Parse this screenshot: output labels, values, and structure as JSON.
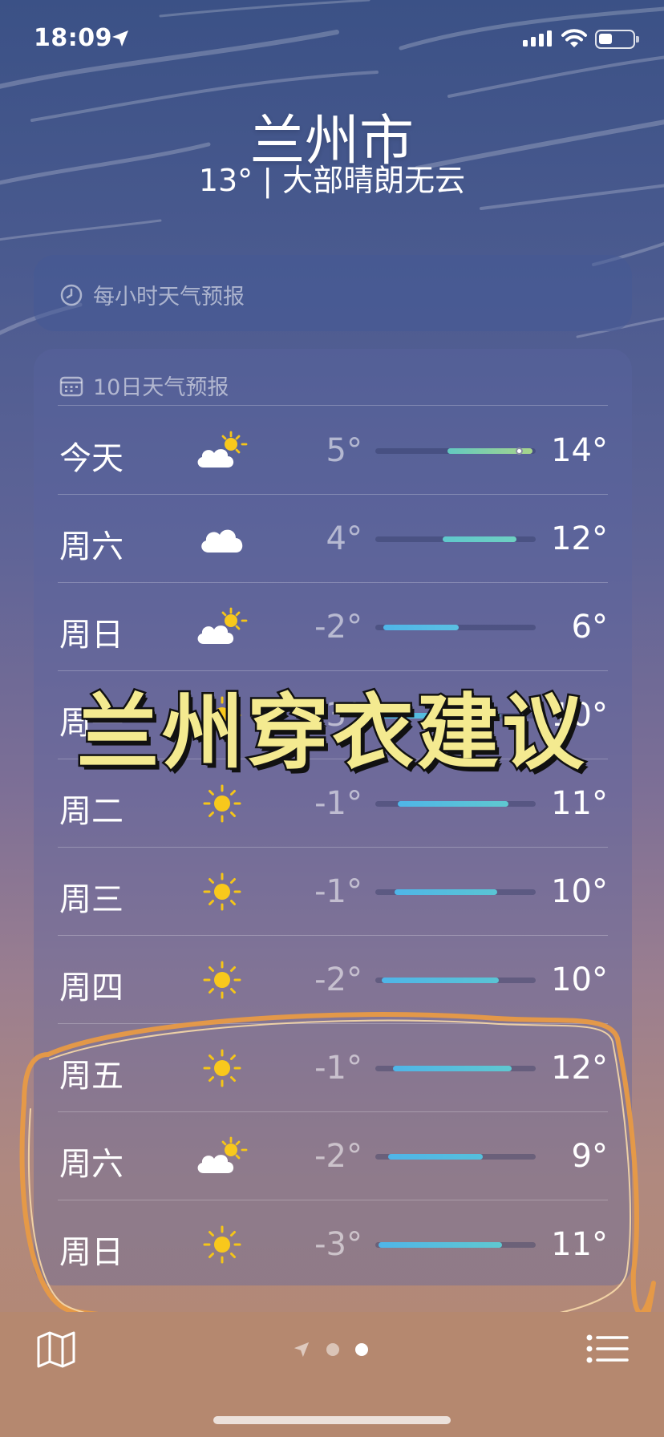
{
  "status_bar": {
    "time": "18:09",
    "battery_level": 0.4
  },
  "header": {
    "city": "兰州市",
    "summary": "13° | 大部晴朗无云"
  },
  "hourly_card": {
    "title": "每小时天气预报"
  },
  "daily_card": {
    "title": "10日天气预报",
    "days": [
      {
        "day": "今天",
        "icon": "partly-sunny-icon",
        "low": "5°",
        "high": "14°",
        "range": [
          0.45,
          0.98
        ],
        "current": 0.9,
        "colors": [
          "#62c9c1",
          "#a7d58a"
        ]
      },
      {
        "day": "周六",
        "icon": "cloud-icon",
        "low": "4°",
        "high": "12°",
        "range": [
          0.42,
          0.88
        ],
        "colors": [
          "#5fc8cc",
          "#6ed0c2"
        ]
      },
      {
        "day": "周日",
        "icon": "partly-sunny-icon",
        "low": "-2°",
        "high": "6°",
        "range": [
          0.05,
          0.52
        ],
        "colors": [
          "#4fb5e8",
          "#5ac0e2"
        ]
      },
      {
        "day": "周一",
        "icon": "sun-icon",
        "low": "-3°",
        "high": "10°",
        "range": [
          0.0,
          0.78
        ],
        "colors": [
          "#4fb5e8",
          "#5fc8d0"
        ]
      },
      {
        "day": "周二",
        "icon": "sun-icon",
        "low": "-1°",
        "high": "11°",
        "range": [
          0.14,
          0.83
        ],
        "colors": [
          "#4fb5e8",
          "#5fc8d0"
        ]
      },
      {
        "day": "周三",
        "icon": "sun-icon",
        "low": "-1°",
        "high": "10°",
        "range": [
          0.12,
          0.76
        ],
        "colors": [
          "#4fb5e8",
          "#5ac4d4"
        ]
      },
      {
        "day": "周四",
        "icon": "sun-icon",
        "low": "-2°",
        "high": "10°",
        "range": [
          0.04,
          0.77
        ],
        "colors": [
          "#4fb5e8",
          "#5ac4d4"
        ]
      },
      {
        "day": "周五",
        "icon": "sun-icon",
        "low": "-1°",
        "high": "12°",
        "range": [
          0.11,
          0.85
        ],
        "colors": [
          "#4fb5e8",
          "#5fc8d0"
        ]
      },
      {
        "day": "周六",
        "icon": "partly-sunny-icon",
        "low": "-2°",
        "high": "9°",
        "range": [
          0.08,
          0.67
        ],
        "colors": [
          "#4fb5e8",
          "#55c0dc"
        ]
      },
      {
        "day": "周日",
        "icon": "sun-icon",
        "low": "-3°",
        "high": "11°",
        "range": [
          0.02,
          0.79
        ],
        "colors": [
          "#4fb5e8",
          "#5fc8d0"
        ]
      }
    ]
  },
  "overlay": {
    "title": "兰州穿衣建议"
  },
  "toolbar": {
    "page_count": 2,
    "active_page": 2
  },
  "colors": {
    "toolbar_bg": "#b5886f",
    "overlay_text": "#f4ea90",
    "scribble": "#e89a45"
  }
}
